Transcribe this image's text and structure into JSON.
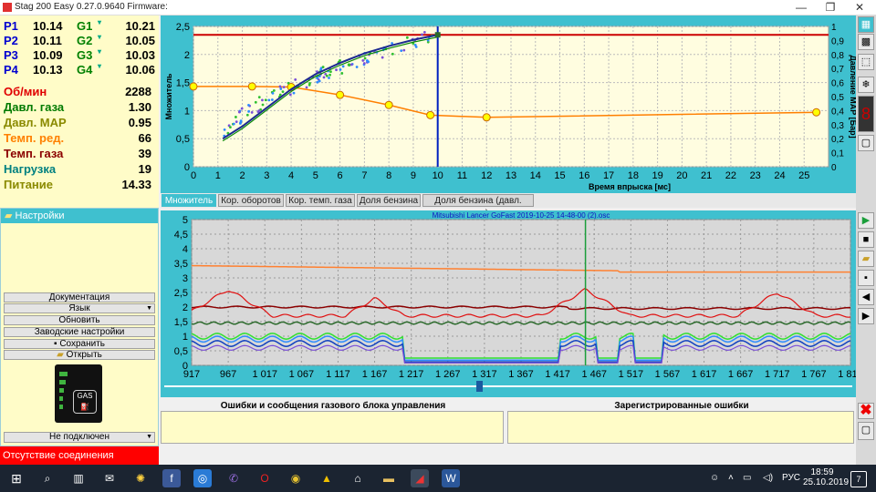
{
  "window": {
    "title": "Stag 200 Easy 0.27.0.9640 Firmware:",
    "controls": {
      "minimize": "—",
      "restore": "❐",
      "close": "✕"
    }
  },
  "params": {
    "injectors": [
      {
        "p_label": "P1",
        "p_value": "10.14",
        "g_label": "G1",
        "g_value": "10.21"
      },
      {
        "p_label": "P2",
        "p_value": "10.11",
        "g_label": "G2",
        "g_value": "10.05"
      },
      {
        "p_label": "P3",
        "p_value": "10.09",
        "g_label": "G3",
        "g_value": "10.03"
      },
      {
        "p_label": "P4",
        "p_value": "10.13",
        "g_label": "G4",
        "g_value": "10.06"
      }
    ],
    "sensors": [
      {
        "label": "Об/мин",
        "value": "2288",
        "color": "#e00000"
      },
      {
        "label": "Давл. газа",
        "value": "1.30",
        "color": "#007a00"
      },
      {
        "label": "Давл. MAP",
        "value": "0.95",
        "color": "#8a8a00"
      },
      {
        "label": "Темп. ред.",
        "value": "66",
        "color": "#ff8000"
      },
      {
        "label": "Темп. газа",
        "value": "39",
        "color": "#8b0000"
      },
      {
        "label": "Нагрузка",
        "value": "19",
        "color": "#008080"
      },
      {
        "label": "Питание",
        "value": "14.33",
        "color": "#8a8a00"
      }
    ]
  },
  "settings": {
    "header": "Настройки",
    "buttons": [
      "Документация",
      "Язык",
      "Обновить",
      "Заводские настройки",
      "Сохранить",
      "Открыть"
    ],
    "connection_select": "Не подключен",
    "status": "Отсутствие соединения",
    "gas_label": "GAS"
  },
  "top_chart": {
    "xlabel": "Время впрыска [мс]",
    "ylabel_left": "Множитель",
    "ylabel_right": "Давление MAP [Бар]",
    "x_ticks": [
      0,
      1,
      2,
      3,
      4,
      5,
      6,
      7,
      8,
      9,
      10,
      11,
      12,
      13,
      14,
      15,
      16,
      17,
      18,
      19,
      20,
      21,
      22,
      23,
      24,
      25
    ],
    "y_left_ticks": [
      "0",
      "0,5",
      "1",
      "1,5",
      "2",
      "2,5"
    ],
    "y_right_ticks": [
      "0",
      "0,1",
      "0,2",
      "0,3",
      "0,4",
      "0,5",
      "0,6",
      "0,7",
      "0,8",
      "0,9",
      "1"
    ],
    "xlim": [
      0,
      26
    ],
    "ylim_left": [
      0,
      2.5
    ],
    "ylim_right": [
      0,
      1
    ],
    "cursor_x": 10,
    "red_line_y": 2.35,
    "orange_points": [
      [
        0,
        1.43
      ],
      [
        2.4,
        1.43
      ],
      [
        4,
        1.42
      ],
      [
        6,
        1.28
      ],
      [
        8,
        1.1
      ],
      [
        9.7,
        0.92
      ],
      [
        12,
        0.88
      ],
      [
        25.5,
        0.97
      ]
    ],
    "blue_curve": [
      [
        1.2,
        0.5
      ],
      [
        2,
        0.72
      ],
      [
        3,
        1.05
      ],
      [
        4,
        1.38
      ],
      [
        5,
        1.65
      ],
      [
        6,
        1.85
      ],
      [
        7,
        2.02
      ],
      [
        8,
        2.15
      ],
      [
        9,
        2.26
      ],
      [
        10,
        2.35
      ]
    ]
  },
  "tabs": [
    "Множитель",
    "Кор. оборотов",
    "Кор. темп. газа",
    "Доля бензина",
    "Доля бензина (давл. газа)"
  ],
  "osc": {
    "title": "Mitsubishi Lancer GoFast 2019-10-25 14-48-00 (2).osc",
    "x_ticks": [
      "917",
      "967",
      "1 017",
      "1 067",
      "1 117",
      "1 167",
      "1 217",
      "1 267",
      "1 317",
      "1 367",
      "1 417",
      "1 467",
      "1 517",
      "1 567",
      "1 617",
      "1 667",
      "1 717",
      "1 767",
      "1 817"
    ],
    "y_ticks": [
      "0",
      "0,5",
      "1",
      "1,5",
      "2",
      "2,5",
      "3",
      "3,5",
      "4",
      "4,5",
      "5"
    ],
    "xlim": [
      917,
      1817
    ],
    "ylim": [
      0,
      5
    ],
    "cursor_x": 1455
  },
  "errors": {
    "left_title": "Ошибки и сообщения газового блока управления",
    "right_title": "Зарегистрированные ошибки"
  },
  "taskbar": {
    "lang": "РУС",
    "time": "18:59",
    "date": "25.10.2019",
    "notifications": "7"
  }
}
